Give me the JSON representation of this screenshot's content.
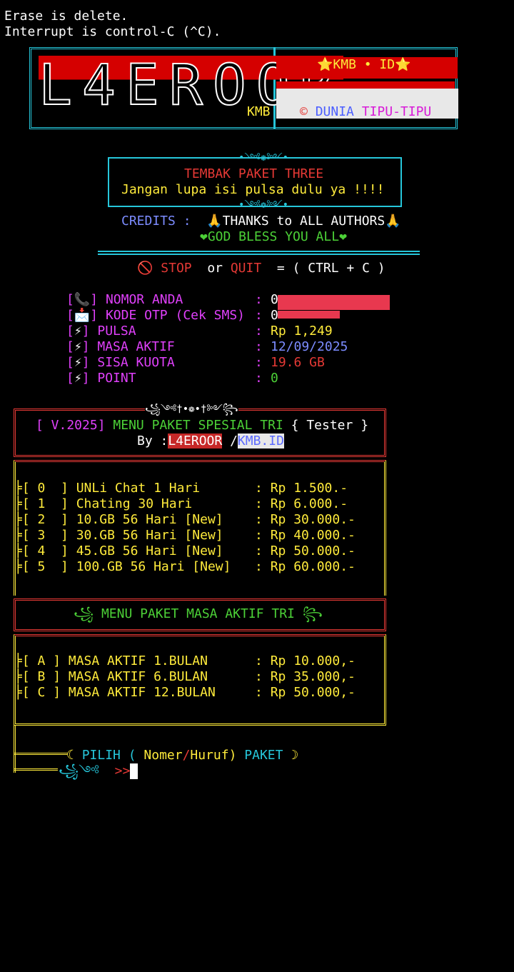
{
  "terminal_header": {
    "line1": "Erase is delete.",
    "line2": "Interrupt is control-C (^C)."
  },
  "banner": {
    "logo_text": "L4EROOR",
    "logo_sub": "KMB",
    "flag_title": "⭐KMB • ID⭐",
    "copyright_symbol": "©",
    "dunia": "DUNIA",
    "tipu": "TIPU-TIPU"
  },
  "intro": {
    "ornament": "•༺❁༻•",
    "title": "TEMBAK PAKET THREE",
    "subtitle": "Jangan lupa isi pulsa dulu ya !!!!",
    "credits_label": "CREDITS :",
    "credits_text": "🙏THANKS to ALL AUTHORS🙏",
    "bless_text": "❤GOD BLESS YOU ALL❤",
    "stop_icon": "🚫",
    "stop": "STOP",
    "or": "or",
    "quit": "QUIT",
    "keys": "= ( CTRL + C )"
  },
  "account": {
    "rows": [
      {
        "icon": "📞",
        "label": "NOMOR ANDA",
        "value": "0"
      },
      {
        "icon": "📩",
        "label": "KODE OTP (Cek SMS)",
        "value": "0"
      },
      {
        "icon": "⚡",
        "label": "PULSA",
        "value": "Rp 1,249"
      },
      {
        "icon": "⚡",
        "label": "MASA AKTIF",
        "value": "12/09/2025"
      },
      {
        "icon": "⚡",
        "label": "SISA KUOTA",
        "value": "19.6 GB"
      },
      {
        "icon": "⚡",
        "label": "POINT",
        "value": "0"
      }
    ]
  },
  "menu1": {
    "ornament": "꧁༺†•❁•†༻꧂",
    "version": "[ V.2025]",
    "title": "MENU PAKET SPESIAL TRI",
    "tester": "{ Tester }",
    "by": "By :",
    "author1": "L4EROOR",
    "author_sep": "/",
    "author2": "KMB.ID",
    "items": [
      {
        "key": "[ 0  ]",
        "name": "UNLi Chat 1 Hari",
        "price": "Rp 1.500.-"
      },
      {
        "key": "[ 1  ]",
        "name": "Chating 30 Hari",
        "price": "Rp 6.000.-"
      },
      {
        "key": "[ 2  ]",
        "name": "10.GB 56 Hari [New]",
        "price": "Rp 30.000.-"
      },
      {
        "key": "[ 3  ]",
        "name": "30.GB 56 Hari [New]",
        "price": "Rp 40.000.-"
      },
      {
        "key": "[ 4  ]",
        "name": "45.GB 56 Hari [New]",
        "price": "Rp 50.000.-"
      },
      {
        "key": "[ 5  ]",
        "name": "100.GB 56 Hari [New]",
        "price": "Rp 60.000.-"
      }
    ]
  },
  "menu2": {
    "title": "MENU PAKET MASA AKTIF TRI",
    "items": [
      {
        "key": "[ A ]",
        "name": "MASA AKTIF 1.BULAN",
        "price": "Rp 10.000,-"
      },
      {
        "key": "[ B ]",
        "name": "MASA AKTIF 6.BULAN",
        "price": "Rp 35.000,-"
      },
      {
        "key": "[ C ]",
        "name": "MASA AKTIF 12.BULAN",
        "price": "Rp 50.000,-"
      }
    ]
  },
  "prompt": {
    "open": "☾",
    "pilih": "PILIH (",
    "nomer": "Nomer",
    "slash": "/",
    "huruf": "Huruf)",
    "paket": "PAKET",
    "close": "☽",
    "arrow_deco": "꧁༺",
    "caret": ">>"
  }
}
